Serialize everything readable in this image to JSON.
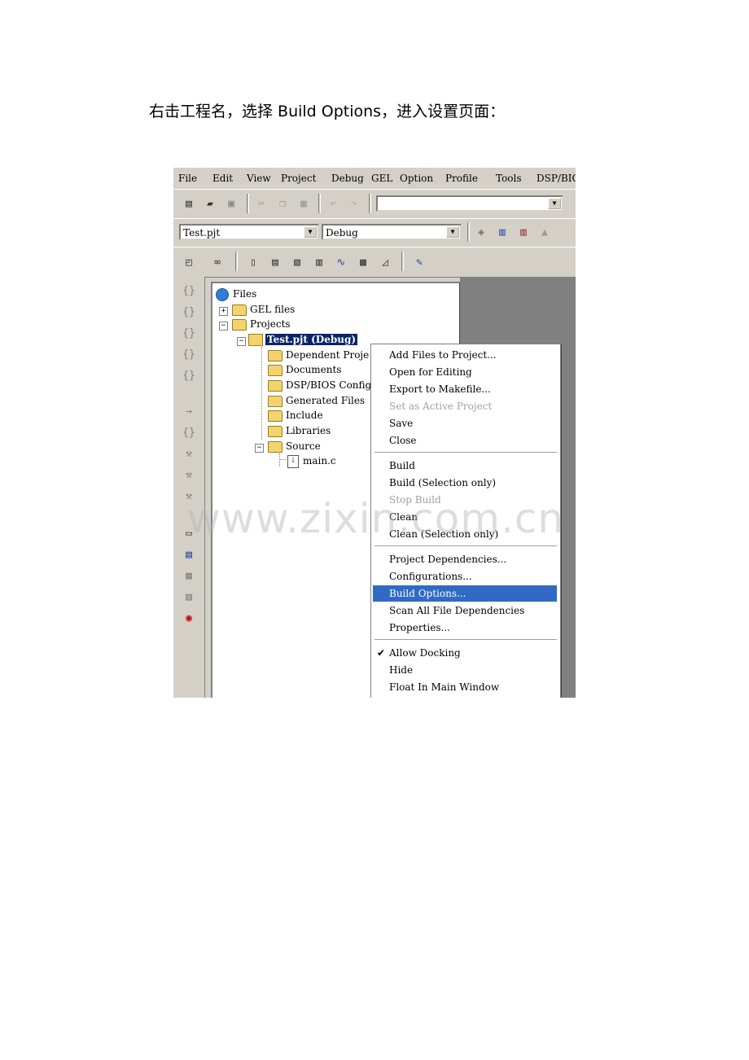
{
  "caption": "右击工程名，选择 Build Options，进入设置页面：",
  "menubar": [
    "File",
    "Edit",
    "View",
    "Project",
    "Debug",
    "GEL",
    "Option",
    "Profile",
    "Tools",
    "DSP/BIO"
  ],
  "toolbar": {
    "search_value": "",
    "project_combo": "Test.pjt",
    "config_combo": "Debug"
  },
  "tree": {
    "root": "Files",
    "gel_files": "GEL files",
    "projects": "Projects",
    "project": "Test.pjt (Debug)",
    "children": [
      "Dependent Proje",
      "Documents",
      "DSP/BIOS Config",
      "Generated Files",
      "Include",
      "Libraries",
      "Source"
    ],
    "source_file": "main.c"
  },
  "context_menu": {
    "group1": [
      "Add Files to Project...",
      "Open for Editing",
      "Export to Makefile...",
      "Set as Active Project",
      "Save",
      "Close"
    ],
    "group2": [
      "Build",
      "Build (Selection only)",
      "Stop Build",
      "Clean",
      "Clean (Selection only)"
    ],
    "group3": [
      "Project Dependencies...",
      "Configurations...",
      "Build Options...",
      "Scan All File Dependencies",
      "Properties..."
    ],
    "group4": [
      "Allow Docking",
      "Hide",
      "Float In Main Window"
    ],
    "disabled": [
      "Set as Active Project",
      "Stop Build"
    ],
    "highlighted": "Build Options...",
    "checked": "Allow Docking",
    "checkmark": "✔"
  },
  "watermark": "www.zixin.com.cn",
  "colors": {
    "menu_highlight": "#316ac5",
    "selection": "#0a246a",
    "chrome": "#d4d0c8"
  }
}
